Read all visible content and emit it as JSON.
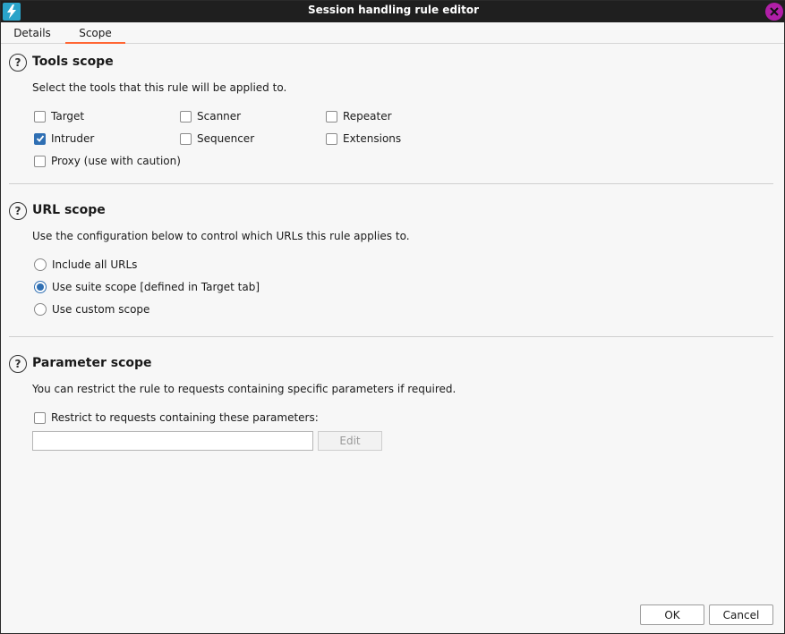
{
  "window": {
    "title": "Session handling rule editor",
    "accent_color": "#ff6633",
    "close_color": "#b01fa7"
  },
  "tabs": [
    {
      "label": "Details",
      "selected": false
    },
    {
      "label": "Scope",
      "selected": true
    }
  ],
  "tools_scope": {
    "title": "Tools scope",
    "description": "Select the tools that this rule will be applied to.",
    "options": [
      {
        "label": "Target",
        "checked": false
      },
      {
        "label": "Scanner",
        "checked": false
      },
      {
        "label": "Repeater",
        "checked": false
      },
      {
        "label": "Intruder",
        "checked": true
      },
      {
        "label": "Sequencer",
        "checked": false
      },
      {
        "label": "Extensions",
        "checked": false
      },
      {
        "label": "Proxy (use with caution)",
        "checked": false
      }
    ]
  },
  "url_scope": {
    "title": "URL scope",
    "description": "Use the configuration below to control which URLs this rule applies to.",
    "options": [
      {
        "label": "Include all URLs",
        "selected": false
      },
      {
        "label": "Use suite scope [defined in Target tab]",
        "selected": true
      },
      {
        "label": "Use custom scope",
        "selected": false
      }
    ]
  },
  "parameter_scope": {
    "title": "Parameter scope",
    "description": "You can restrict the rule to requests containing specific parameters if required.",
    "restrict_label": "Restrict to requests containing these parameters:",
    "restrict_checked": false,
    "parameters_value": "",
    "edit_label": "Edit"
  },
  "footer": {
    "ok_label": "OK",
    "cancel_label": "Cancel"
  },
  "icons": {
    "help": "?",
    "check": "✓"
  }
}
